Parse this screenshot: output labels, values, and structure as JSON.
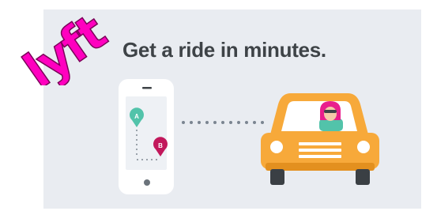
{
  "brand": {
    "logo_text": "lyft",
    "colors": {
      "brand_pink": "#ff00bf",
      "banner_bg": "#e9ecf1",
      "headline": "#3e4347",
      "car_orange": "#f7a93a",
      "pin_a": "#52c3aa",
      "pin_b": "#c2185b"
    }
  },
  "headline": "Get a ride in minutes.",
  "phone": {
    "pin_a_label": "A",
    "pin_b_label": "B"
  },
  "icons": [
    "lyft-logo",
    "phone-icon",
    "map-pin-a-icon",
    "map-pin-b-icon",
    "dotted-connector",
    "car-icon",
    "driver-icon"
  ]
}
